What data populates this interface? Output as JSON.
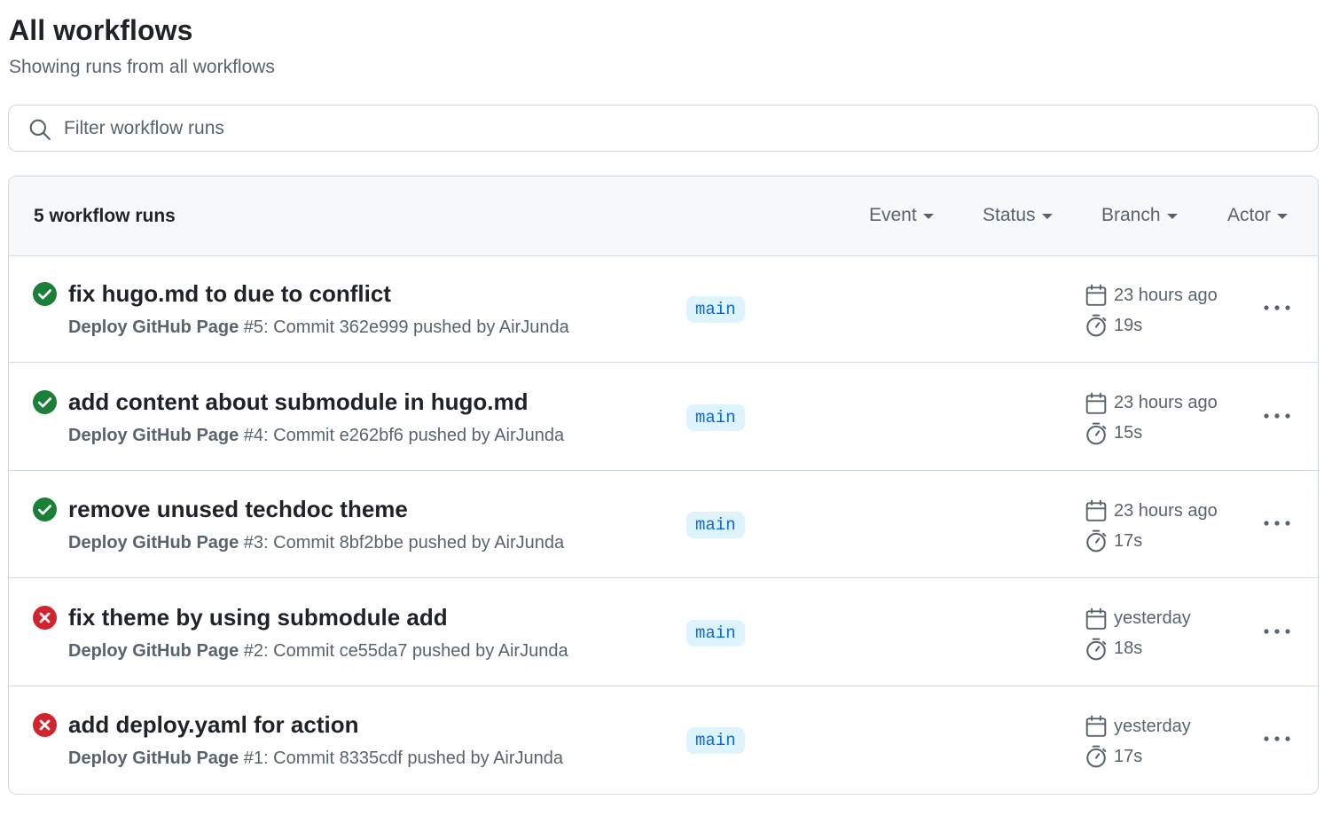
{
  "header": {
    "title": "All workflows",
    "subtitle": "Showing runs from all workflows"
  },
  "search": {
    "placeholder": "Filter workflow runs",
    "value": "",
    "icon": "search-icon"
  },
  "list": {
    "count_label": "5 workflow runs",
    "filters": [
      "Event",
      "Status",
      "Branch",
      "Actor"
    ],
    "runs": [
      {
        "status": "success",
        "title": "fix hugo.md to due to conflict",
        "workflow": "Deploy GitHub Page",
        "detail": " #5: Commit 362e999 pushed by AirJunda",
        "branch": "main",
        "when": "23 hours ago",
        "duration": "19s"
      },
      {
        "status": "success",
        "title": "add content about submodule in hugo.md",
        "workflow": "Deploy GitHub Page",
        "detail": " #4: Commit e262bf6 pushed by AirJunda",
        "branch": "main",
        "when": "23 hours ago",
        "duration": "15s"
      },
      {
        "status": "success",
        "title": "remove unused techdoc theme",
        "workflow": "Deploy GitHub Page",
        "detail": " #3: Commit 8bf2bbe pushed by AirJunda",
        "branch": "main",
        "when": "23 hours ago",
        "duration": "17s"
      },
      {
        "status": "failure",
        "title": "fix theme by using submodule add",
        "workflow": "Deploy GitHub Page",
        "detail": " #2: Commit ce55da7 pushed by AirJunda",
        "branch": "main",
        "when": "yesterday",
        "duration": "18s"
      },
      {
        "status": "failure",
        "title": "add deploy.yaml for action",
        "workflow": "Deploy GitHub Page",
        "detail": " #1: Commit 8335cdf pushed by AirJunda",
        "branch": "main",
        "when": "yesterday",
        "duration": "17s"
      }
    ]
  },
  "colors": {
    "success": "#1a7f37",
    "failure": "#d1242f",
    "branch_bg": "#ddf4ff",
    "branch_fg": "#0969da",
    "muted": "#59636e"
  },
  "icons": {
    "success": "check-circle-icon",
    "failure": "x-circle-icon",
    "when": "calendar-icon",
    "duration": "stopwatch-icon",
    "menu": "kebab-horizontal-icon"
  }
}
